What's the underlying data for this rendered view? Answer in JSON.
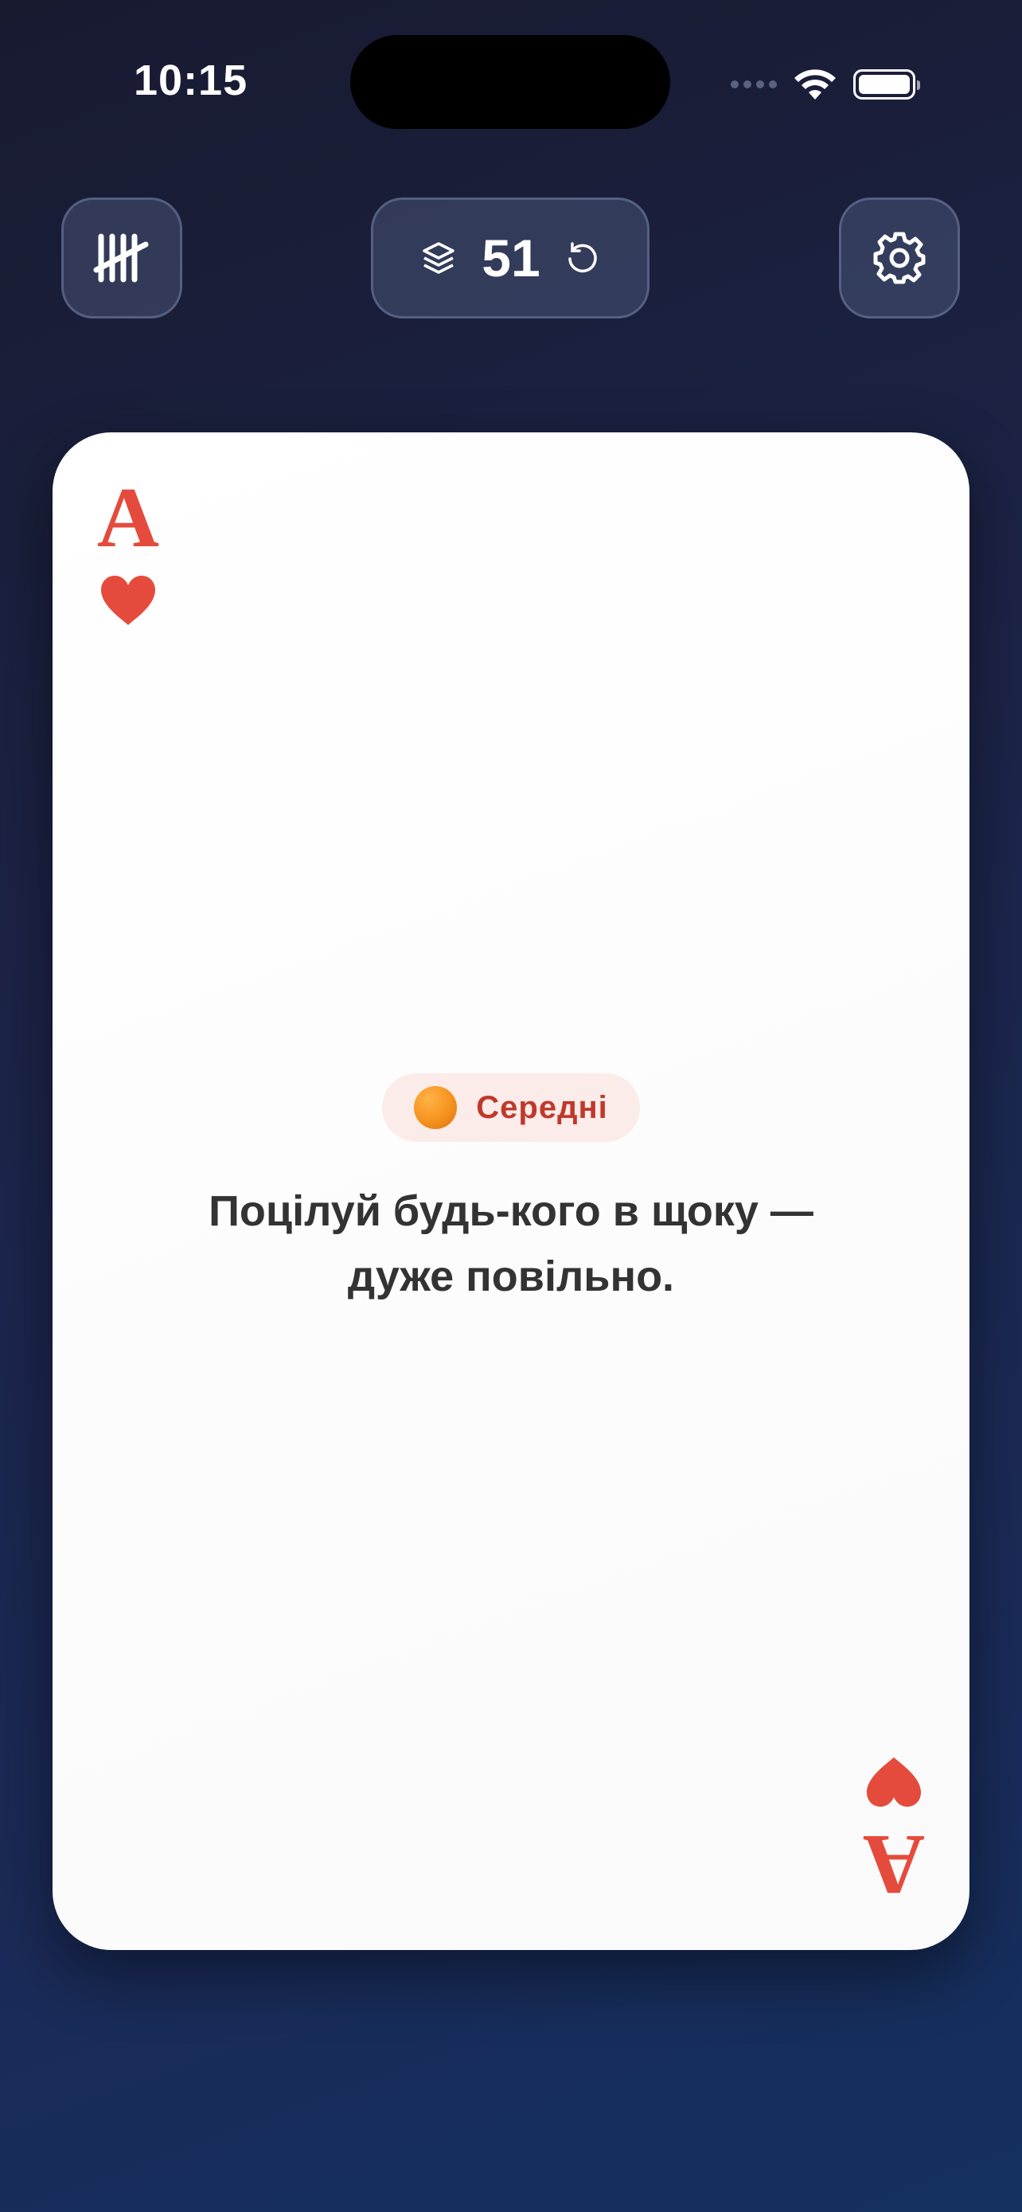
{
  "status_bar": {
    "time": "10:15",
    "icons": [
      "signal-icon",
      "wifi-icon",
      "battery-icon"
    ]
  },
  "toolbar": {
    "left_button_icon": "tally-marks-icon",
    "deck_icon": "layers-icon",
    "deck_count": "51",
    "reset_icon": "reset-icon",
    "settings_icon": "gear-icon"
  },
  "card": {
    "rank": "A",
    "suit": "heart",
    "level_label": "Середні",
    "level_icon": "orange-circle-icon",
    "text": "Поцілуй будь-кого в щоку — дуже повільно."
  },
  "colors": {
    "accent_red": "#e54b3c",
    "level_text": "#c0392b",
    "level_badge_bg": "#fbecea",
    "background": "#1c2448"
  }
}
